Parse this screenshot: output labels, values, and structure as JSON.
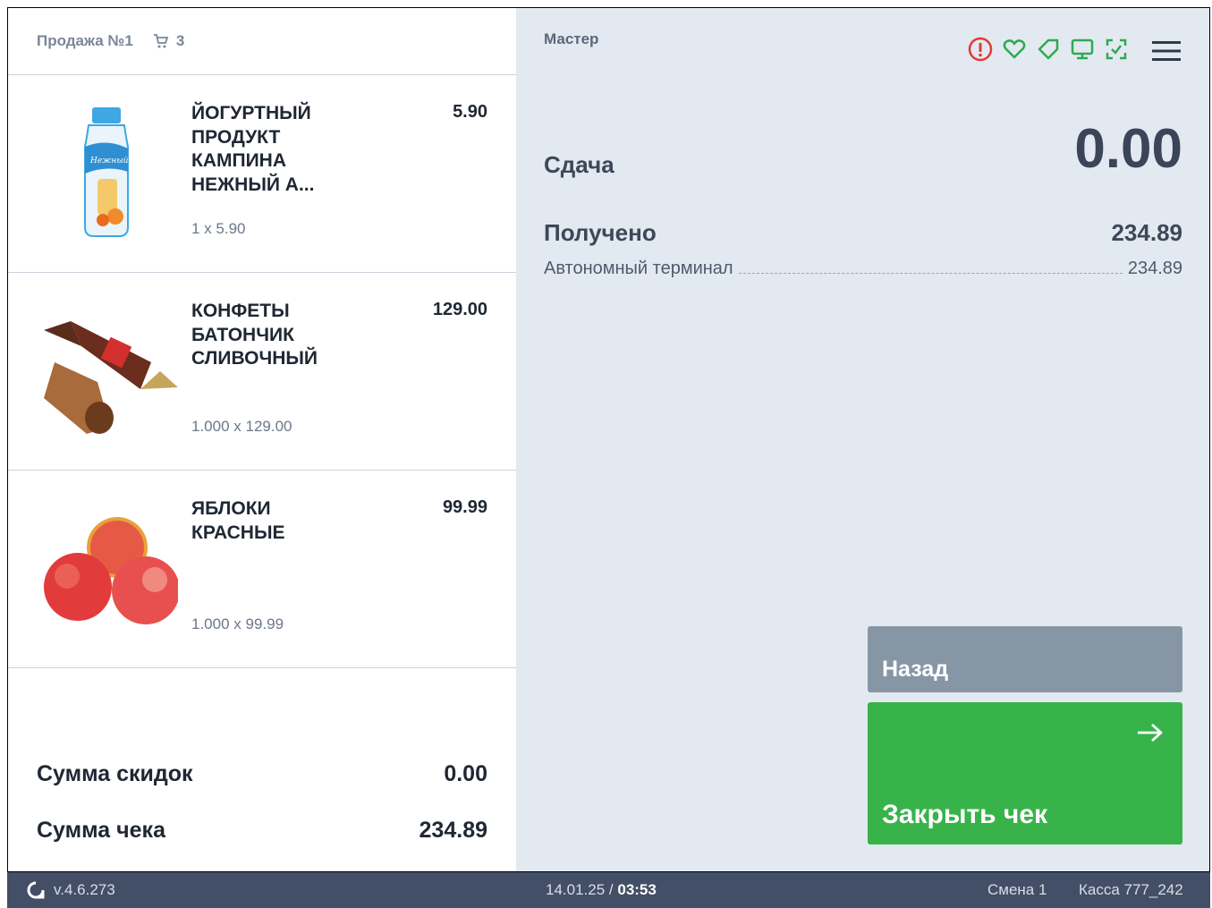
{
  "header": {
    "sale_title": "Продажа №1",
    "cart_count": "3"
  },
  "items": [
    {
      "name": "ЙОГУРТНЫЙ ПРОДУКТ КАМПИНА НЕЖНЫЙ А...",
      "price": "5.90",
      "qty": "1 x 5.90",
      "image": "yogurt-bottle"
    },
    {
      "name": "КОНФЕТЫ БАТОНЧИК СЛИВОЧНЫЙ",
      "price": "129.00",
      "qty": "1.000 x 129.00",
      "image": "candy"
    },
    {
      "name": "ЯБЛОКИ КРАСНЫЕ",
      "price": "99.99",
      "qty": "1.000 x 99.99",
      "image": "apples"
    }
  ],
  "totals": {
    "discount_label": "Сумма скидок",
    "discount_value": "0.00",
    "check_label": "Сумма чека",
    "check_value": "234.89"
  },
  "right": {
    "mode": "Мастер",
    "change_label": "Сдача",
    "change_value": "0.00",
    "received_label": "Получено",
    "received_value": "234.89",
    "payment_method": "Автономный терминал",
    "payment_value": "234.89",
    "back_label": "Назад",
    "close_label": "Закрыть чек"
  },
  "status_icons": [
    "alert-icon",
    "heart-icon",
    "tag-icon",
    "monitor-icon",
    "scan-icon"
  ],
  "colors": {
    "alert": "#e53935",
    "ok": "#2eaa52",
    "primary": "#37b34a",
    "secondary": "#8796a5",
    "footer": "#434f66"
  },
  "footer": {
    "version": "v.4.6.273",
    "date": "14.01.25",
    "time": "03:53",
    "shift": "Смена 1",
    "kassa": "Касса 777_242"
  }
}
